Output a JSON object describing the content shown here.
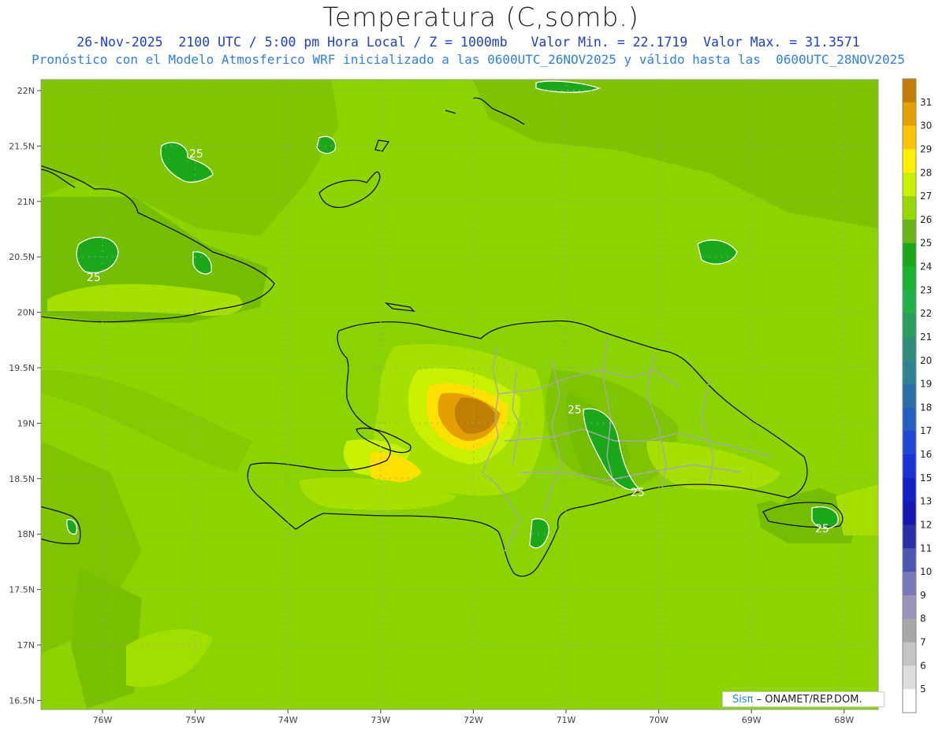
{
  "title": "Temperatura (C,somb.)",
  "subtitle_line1": "26-Nov-2025  2100 UTC / 5:00 pm Hora Local / Z = 1000mb   Valor Min. = 22.1719  Valor Max. = 31.3571",
  "subtitle_line2": "Pronóstico con el Modelo Atmosferico WRF inicializado a las 0600UTC_26NOV2025 y válido hasta las  0600UTC_28NOV2025",
  "credit": {
    "brand": "Sisπ",
    "text": " – ONAMET/REP.DOM."
  },
  "map": {
    "lon_range": [
      -76.65,
      -67.6
    ],
    "lat_range": [
      16.42,
      22.1
    ],
    "lat_ticks": [
      "22N",
      "21.5N",
      "21N",
      "20.5N",
      "20N",
      "19.5N",
      "19N",
      "18.5N",
      "18N",
      "17.5N",
      "17N",
      "16.5N"
    ],
    "lon_ticks": [
      "76W",
      "75W",
      "74W",
      "73W",
      "72W",
      "71W",
      "70W",
      "69W",
      "68W"
    ],
    "contour_label": "25",
    "contour_labels": [
      "25",
      "25",
      "25",
      "25",
      "25"
    ]
  },
  "colorbar": {
    "labels": [
      "31",
      "30",
      "29",
      "28",
      "27",
      "26",
      "25",
      "24",
      "23",
      "22",
      "21",
      "20",
      "19",
      "18",
      "17",
      "16",
      "15",
      "13",
      "12",
      "11",
      "10",
      "9",
      "8",
      "7",
      "6",
      "5"
    ],
    "colors": [
      "#c07f00",
      "#e5a000",
      "#ffc400",
      "#ffef00",
      "#c8f000",
      "#96d900",
      "#6cb41a",
      "#1aa81a",
      "#18b430",
      "#23b04c",
      "#2a9e5e",
      "#2f8f78",
      "#2c8492",
      "#2771a8",
      "#2460bf",
      "#1f48d4",
      "#1a33d0",
      "#1520c4",
      "#1418b0",
      "#2b30a8",
      "#4d57b0",
      "#7a78b8",
      "#9a94b8",
      "#a7a7a7",
      "#c4c4c4",
      "#dddddd",
      "#ffffff"
    ]
  }
}
